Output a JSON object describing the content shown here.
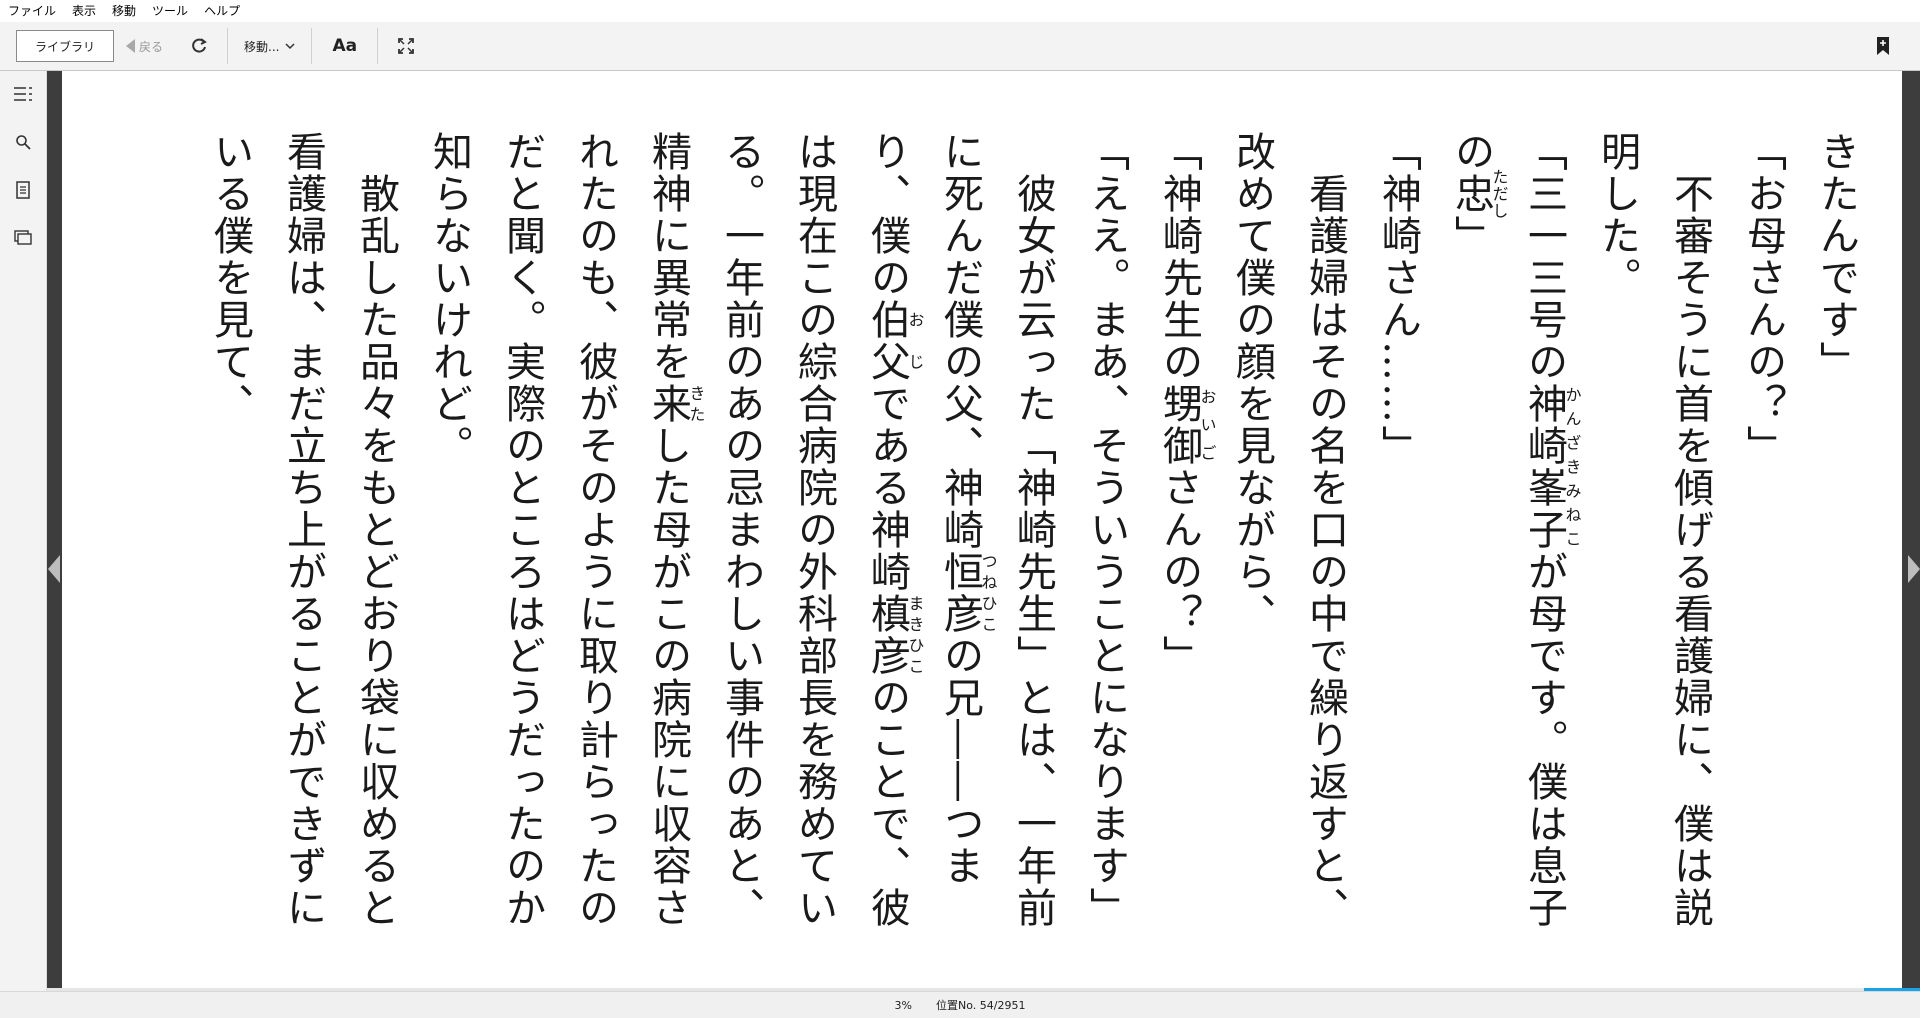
{
  "menu": [
    "ファイル",
    "表示",
    "移動",
    "ツール",
    "ヘルプ"
  ],
  "toolbar": {
    "library_label": "ライブラリ",
    "back_label": "戻る",
    "goto_label": "移動...",
    "font_label": "Aa"
  },
  "icons": {
    "refresh": "refresh-icon",
    "chevron": "chevron-down-icon",
    "fullscreen": "fullscreen-icon",
    "bookmark": "bookmark-add-icon",
    "toc": "toc-icon",
    "search": "search-icon",
    "notes": "notes-icon",
    "pages": "pages-icon"
  },
  "text": {
    "l1": "きたんです」",
    "l2": "「お母さんの？」",
    "l3": "　不審そうに首を傾げる看護婦に、僕は説",
    "l4": "明した。",
    "l5a": "「三一三号の",
    "l5b": "神崎峯子",
    "l5b_rt": "かんざきみねこ",
    "l5c": "が母です。僕は息子",
    "l6a": "の",
    "l6b": "忠",
    "l6b_rt": "ただし",
    "l6c": "」",
    "l7": "「神崎さん……」",
    "l8": "　看護婦はその名を口の中で繰り返すと、",
    "l9": "改めて僕の顔を見ながら、",
    "l10a": "「神崎先生の",
    "l10b": "甥御",
    "l10b_rt": "おいご",
    "l10c": "さんの？」",
    "l11": "「ええ。まあ、そういうことになります」",
    "l12": "　彼女が云った「神崎先生」とは、一年前",
    "l13a": "に死んだ僕の父、神崎",
    "l13b": "恒彦",
    "l13b_rt": "つねひこ",
    "l13c": "の兄――つま",
    "l14a": "り、僕の",
    "l14b": "伯父",
    "l14b_rt": "おじ",
    "l14c": "である神崎",
    "l14d": "槙彦",
    "l14d_rt": "まきひこ",
    "l14e": "のことで、彼",
    "l15": "は現在この綜合病院の外科部長を務めてい",
    "l16": "る。一年前のあの忌まわしい事件のあと、",
    "l17a": "精神に異常を",
    "l17b": "来",
    "l17b_rt": "きた",
    "l17c": "した母がこの病院に収容さ",
    "l18": "れたのも、彼がそのように取り計らったの",
    "l19": "だと聞く。実際のところはどうだったのか",
    "l20": "知らないけれど。",
    "l21": "　散乱した品々をもとどおり袋に収めると",
    "l22": "看護婦は、まだ立ち上がることができずに",
    "l23": "いる僕を見て、"
  },
  "status": {
    "percent": "3%",
    "location": "位置No. 54/2951"
  },
  "progress_fraction": 0.03,
  "colors": {
    "accent": "#1aa3e8",
    "frame": "#3d3d3d"
  }
}
